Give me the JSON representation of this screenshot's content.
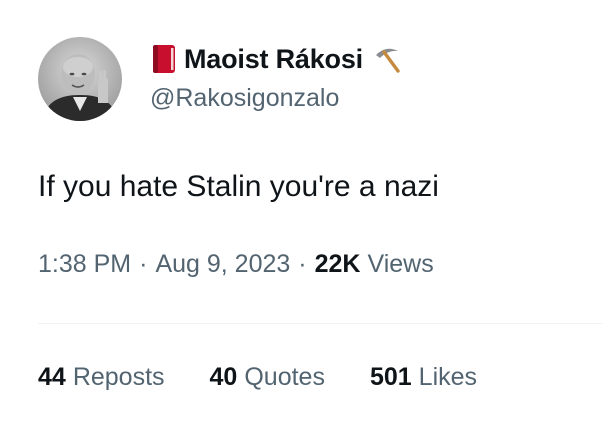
{
  "user": {
    "display_name": "Maoist Rákosi",
    "handle": "@Rakosigonzalo",
    "name_prefix_icon": "red-book-emoji",
    "name_suffix_icon": "pick-emoji"
  },
  "tweet": {
    "text": "If you hate Stalin you're a nazi",
    "time": "1:38 PM",
    "date": "Aug 9, 2023",
    "views_count": "22K",
    "views_label": "Views"
  },
  "stats": {
    "reposts": {
      "count": "44",
      "label": "Reposts"
    },
    "quotes": {
      "count": "40",
      "label": "Quotes"
    },
    "likes": {
      "count": "501",
      "label": "Likes"
    }
  },
  "colors": {
    "primary_text": "#0f1419",
    "secondary_text": "#536471",
    "divider": "#eff3f4"
  }
}
